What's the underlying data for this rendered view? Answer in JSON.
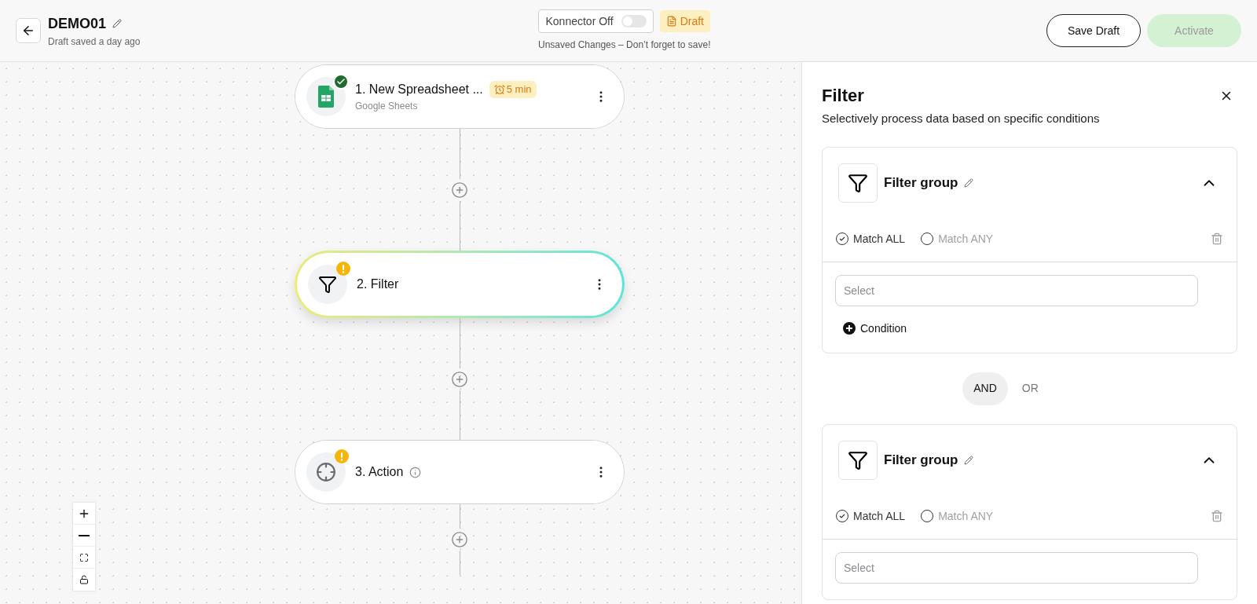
{
  "header": {
    "title": "DEMO01",
    "subtitle": "Draft saved a day ago",
    "toggle": {
      "label": "Konnector Off",
      "on": false
    },
    "status": "Draft",
    "notice": "Unsaved Changes – Don’t forget to save!",
    "buttons": [
      {
        "label": "Save Draft",
        "kind": "outline",
        "disabled": false
      },
      {
        "label": "Activate",
        "kind": "primary",
        "disabled": true
      }
    ]
  },
  "nodes": [
    {
      "title": "1. New Spreadsheet ...",
      "subtitle": "Google Sheets",
      "badge": "5 min",
      "complete": true,
      "kind": "trigger",
      "info": false,
      "selected": false
    },
    {
      "title": "2. Filter",
      "complete": false,
      "kind": "filter",
      "info": false,
      "selected": true
    },
    {
      "title": "3. Action",
      "complete": false,
      "kind": "action",
      "info": true,
      "selected": false
    }
  ],
  "panel": {
    "title": "Filter",
    "description": "Selectively process data based on specific conditions",
    "groups": [
      {
        "title": "Filter group",
        "expanded": true,
        "match": [
          {
            "label": "Match ALL",
            "selected": true
          },
          {
            "label": "Match ANY",
            "selected": false
          }
        ],
        "placeholder": "Select",
        "add_label": "Condition"
      },
      {
        "title": "Filter group",
        "expanded": true,
        "match": [
          {
            "label": "Match ALL",
            "selected": true
          },
          {
            "label": "Match ANY",
            "selected": false
          }
        ],
        "placeholder": "Select"
      }
    ],
    "joins": [
      {
        "label": "AND",
        "selected": true
      },
      {
        "label": "OR",
        "selected": false
      }
    ]
  }
}
